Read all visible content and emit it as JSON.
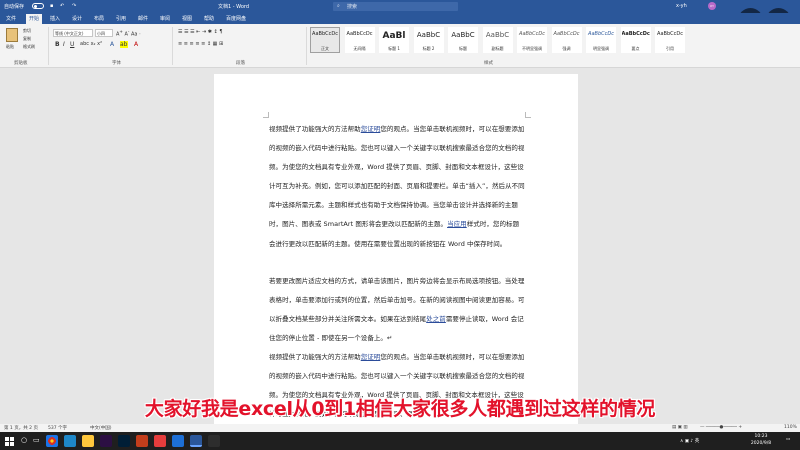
{
  "titlebar": {
    "autosave": "自动保存",
    "doc_name": "文档1 - Word",
    "search_placeholder": "搜索",
    "user": "x-yh",
    "avatar_initials": "XY"
  },
  "tabs": [
    "文件",
    "开始",
    "插入",
    "设计",
    "布局",
    "引用",
    "邮件",
    "审阅",
    "视图",
    "帮助",
    "百度网盘"
  ],
  "ribbon": {
    "clipboard": {
      "paste": "粘贴",
      "cut": "剪切",
      "copy": "复制",
      "format_painter": "格式刷",
      "label": "剪贴板"
    },
    "font": {
      "name": "等线 (中文正文)",
      "size": "小四",
      "label": "字体"
    },
    "paragraph": {
      "label": "段落"
    },
    "styles": {
      "label": "样式",
      "items": [
        {
          "preview": "AaBbCcDc",
          "name": "正文"
        },
        {
          "preview": "AaBbCcDc",
          "name": "无间隔"
        },
        {
          "preview": "AaBl",
          "name": "标题 1"
        },
        {
          "preview": "AaBbC",
          "name": "标题 2"
        },
        {
          "preview": "AaBbC",
          "name": "标题"
        },
        {
          "preview": "AaBbC",
          "name": "副标题"
        },
        {
          "preview": "AaBbCcDc",
          "name": "不明显强调"
        },
        {
          "preview": "AaBbCcDc",
          "name": "强调"
        },
        {
          "preview": "AaBbCcDc",
          "name": "明显强调"
        },
        {
          "preview": "AaBbCcDc",
          "name": "要点"
        },
        {
          "preview": "AaBbCcDc",
          "name": "引用"
        }
      ]
    }
  },
  "document": {
    "p1_a": "视频提供了功能强大的方法帮助",
    "p1_link": "您证明",
    "p1_b": "您的观点。当您单击联机视频时，可以在想要添加的视频的嵌入代码中进行粘贴。您也可以键入一个关键字以联机搜索最适合您的文档的视频。为使您的文档具有专业外观，Word 提供了页眉、页脚、封面和文本框设计，这些设计可互为补充。例如，您可以添加匹配的封面、页眉和提要栏。单击“插入”，然后从不同库中选择所需元素。主题和样式也有助于文档保持协调。当您单击设计并选择新的主题时，图片、图表或 SmartArt 图形将会更改以匹配新的主题。",
    "p1_link2": "当应用",
    "p1_c": "样式时，您的标题会进行更改以匹配新的主题。使用在需要位置出现的新按钮在 Word 中保存时间。",
    "p2_a": "若要更改图片适应文档的方式，请单击该图片，图片旁边将会显示布局选项按钮。当处理表格时，单击要添加行或列的位置，然后单击加号。在新的阅读视图中阅读更加容易。可以折叠文档某些部分并关注所需文本。如果在达到结尾",
    "p2_link": "处之前",
    "p2_b": "需要停止读取，Word 会记住您的停止位置 - 即使在另一个设备上。↵",
    "p3_a": "视频提供了功能强大的方法帮助",
    "p3_link": "您证明",
    "p3_b": "您的观点。当您单击联机视频时，可以在想要添加的视频的嵌入代码中进行粘贴。您也可以键入一个关键字以联机搜索最适合您的文档的视频。为使您的文档具有专业外观，Word 提供了页眉、页脚、封面和文本框设计，这些设计可互为补充。例如，您可以添加匹配的封面、页眉"
  },
  "subtitle": "大家好我是excel从0到1相信大家很多人都遇到过这样的情况",
  "statusbar": {
    "page": "第 1 页，共 2 页",
    "words": "537 个字",
    "lang": "中文(中国)",
    "zoom": "110%"
  },
  "taskbar": {
    "search_placeholder": "在这里输入你要搜索的内容",
    "time": "10:23",
    "date": "2020/9/8"
  },
  "colors": {
    "brand": "#2b579a",
    "subtitle": "#e3122b"
  }
}
